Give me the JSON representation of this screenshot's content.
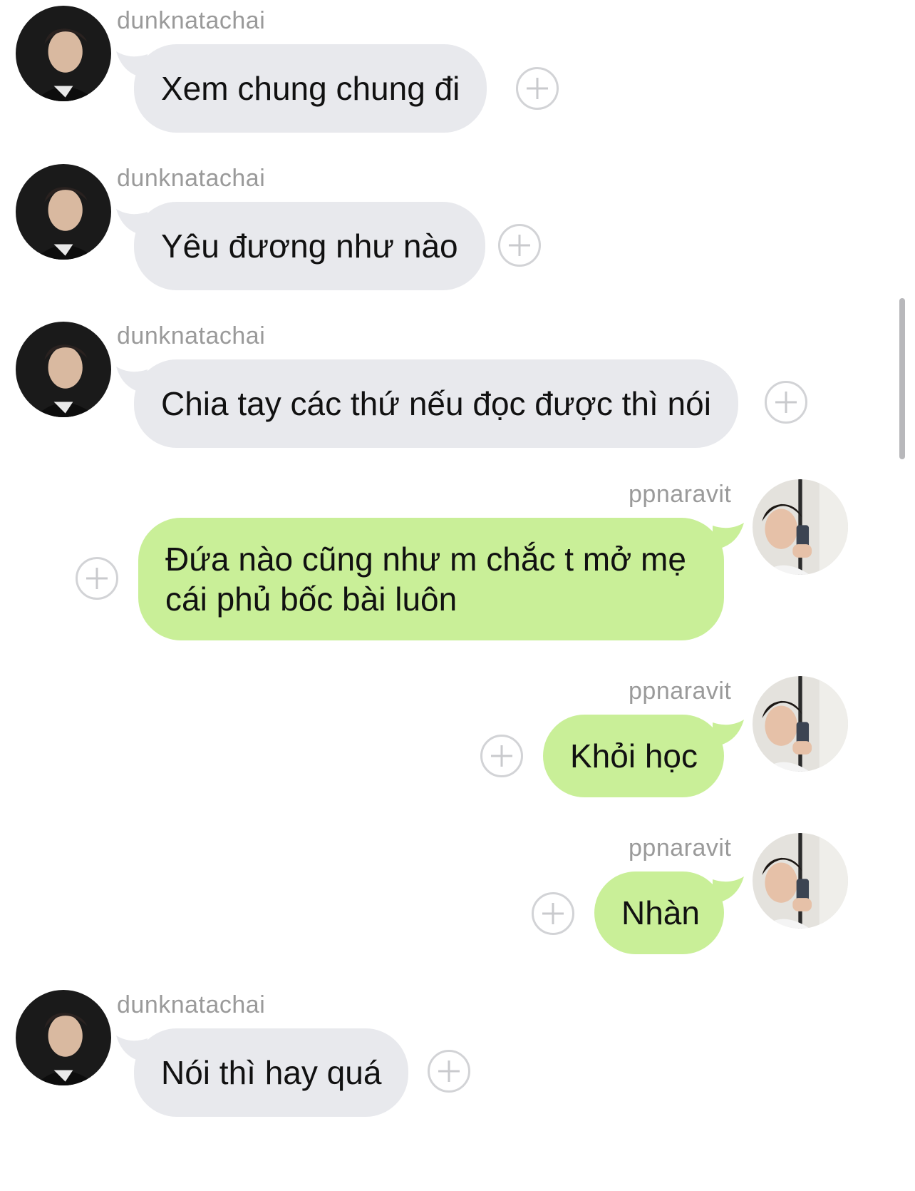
{
  "colors": {
    "incoming_bubble": "#e8e9ed",
    "outgoing_bubble": "#c9ef98",
    "sender_name": "#9a9a9a",
    "add_reaction_icon": "#d2d3d6"
  },
  "messages": [
    {
      "direction": "incoming",
      "sender": "dunknatachai",
      "text": "Xem chung chung đi",
      "avatar": "dunknatachai-avatar",
      "action_icon": "add-reaction-icon"
    },
    {
      "direction": "incoming",
      "sender": "dunknatachai",
      "text": "Yêu đương như nào",
      "avatar": "dunknatachai-avatar",
      "action_icon": "add-reaction-icon"
    },
    {
      "direction": "incoming",
      "sender": "dunknatachai",
      "text": "Chia tay các thứ nếu đọc được thì nói",
      "avatar": "dunknatachai-avatar",
      "action_icon": "add-reaction-icon"
    },
    {
      "direction": "outgoing",
      "sender": "ppnaravit",
      "text": "Đứa nào cũng như m chắc t mở mẹ cái phủ bốc bài luôn",
      "avatar": "ppnaravit-avatar",
      "action_icon": "add-reaction-icon"
    },
    {
      "direction": "outgoing",
      "sender": "ppnaravit",
      "text": "Khỏi học",
      "avatar": "ppnaravit-avatar",
      "action_icon": "add-reaction-icon"
    },
    {
      "direction": "outgoing",
      "sender": "ppnaravit",
      "text": "Nhàn",
      "avatar": "ppnaravit-avatar",
      "action_icon": "add-reaction-icon"
    },
    {
      "direction": "incoming",
      "sender": "dunknatachai",
      "text": "Nói thì hay quá",
      "avatar": "dunknatachai-avatar",
      "action_icon": "add-reaction-icon"
    }
  ]
}
